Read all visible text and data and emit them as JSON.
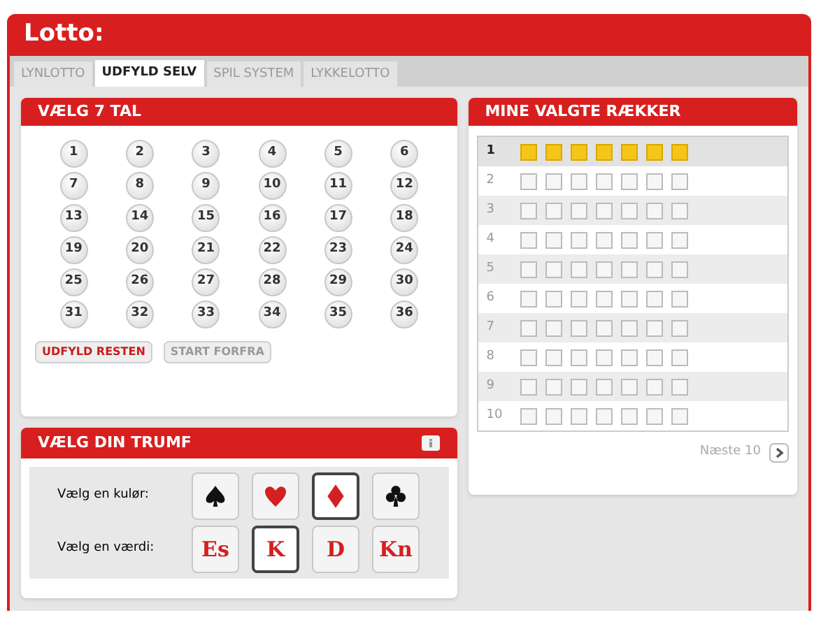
{
  "window": {
    "title": "Lotto:"
  },
  "tabs": [
    {
      "label": "LYNLOTTO",
      "selected": false
    },
    {
      "label": "UDFYLD SELV",
      "selected": true
    },
    {
      "label": "SPIL SYSTEM",
      "selected": false
    },
    {
      "label": "LYKKELOTTO",
      "selected": false
    }
  ],
  "pick_panel": {
    "title": "VÆLG 7 TAL",
    "numbers": [
      "1",
      "2",
      "3",
      "4",
      "5",
      "6",
      "7",
      "8",
      "9",
      "10",
      "11",
      "12",
      "13",
      "14",
      "15",
      "16",
      "17",
      "18",
      "19",
      "20",
      "21",
      "22",
      "23",
      "24",
      "25",
      "26",
      "27",
      "28",
      "29",
      "30",
      "31",
      "32",
      "33",
      "34",
      "35",
      "36"
    ],
    "buttons": [
      {
        "label": "UDFYLD RESTEN",
        "kind": "primary"
      },
      {
        "label": "START FORFRA",
        "kind": "secondary"
      }
    ]
  },
  "trump_panel": {
    "title": "VÆLG DIN TRUMF",
    "suit_label": "Vælg en kulør:",
    "value_label": "Vælg en værdi:",
    "suits": [
      {
        "kind": "spade",
        "color": "#111111",
        "selected": false
      },
      {
        "kind": "heart",
        "color": "#d42020",
        "selected": false
      },
      {
        "kind": "diamond",
        "color": "#d42020",
        "selected": true
      },
      {
        "kind": "club",
        "color": "#111111",
        "selected": false
      }
    ],
    "values": [
      {
        "label": "Es",
        "selected": false
      },
      {
        "label": "K",
        "selected": true
      },
      {
        "label": "D",
        "selected": false
      },
      {
        "label": "Kn",
        "selected": false
      }
    ]
  },
  "rows_panel": {
    "title": "MINE VALGTE RÆKKER",
    "rows": [
      {
        "label": "1",
        "selected": true
      },
      {
        "label": "2",
        "selected": false
      },
      {
        "label": "3",
        "selected": false
      },
      {
        "label": "4",
        "selected": false
      },
      {
        "label": "5",
        "selected": false
      },
      {
        "label": "6",
        "selected": false
      },
      {
        "label": "7",
        "selected": false
      },
      {
        "label": "8",
        "selected": false
      },
      {
        "label": "9",
        "selected": false
      },
      {
        "label": "10",
        "selected": false
      }
    ],
    "next": "Næste 10"
  }
}
